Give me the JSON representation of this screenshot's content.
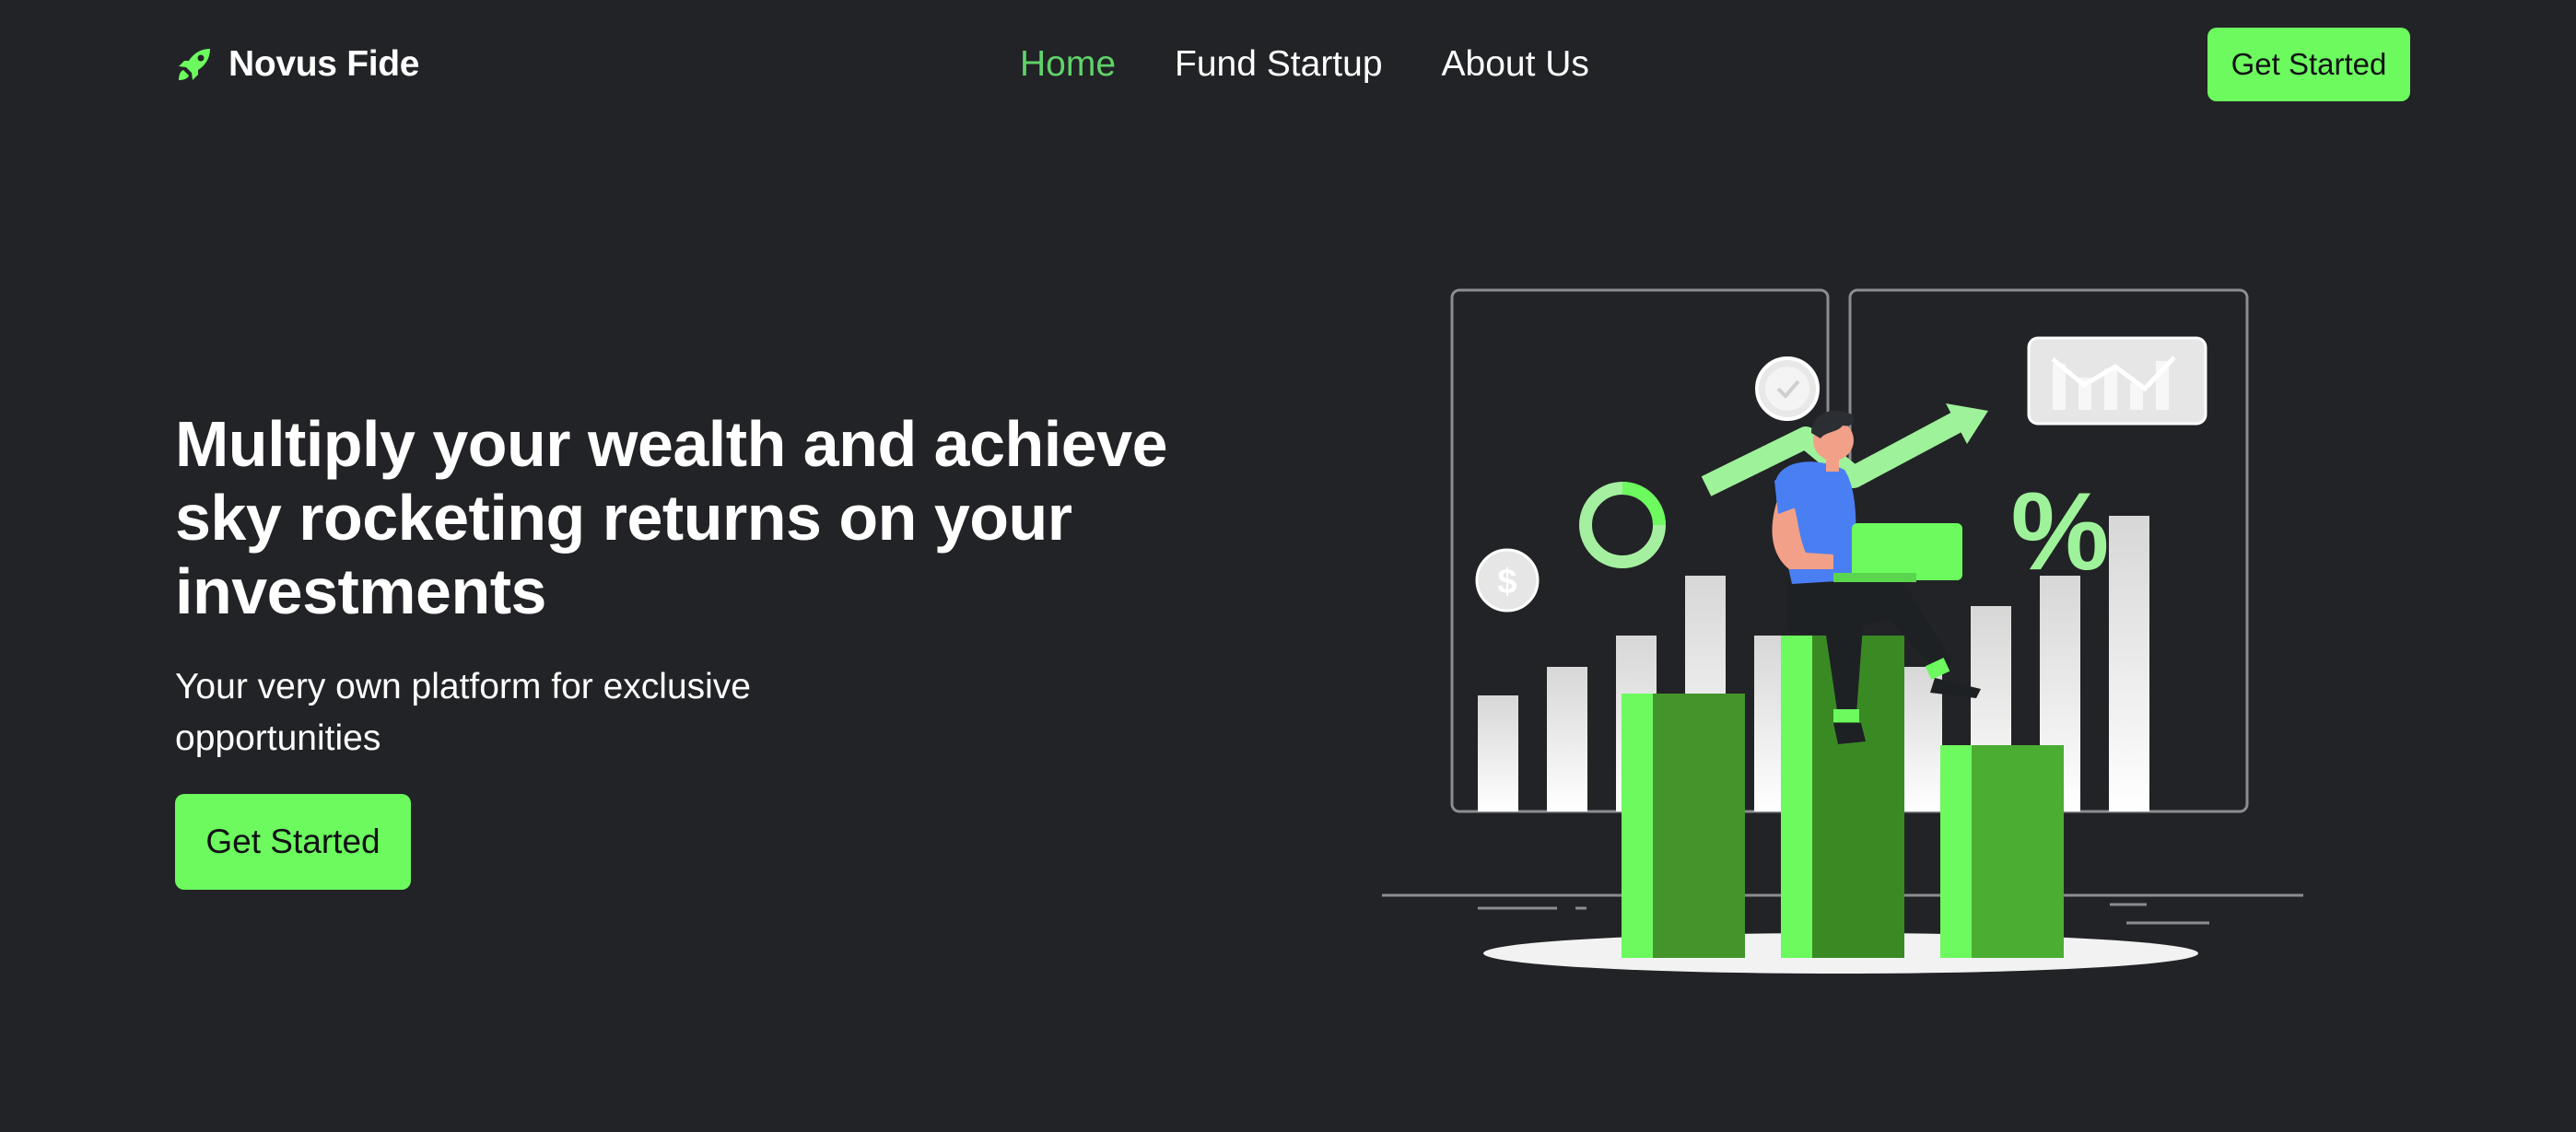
{
  "brand": {
    "name": "Novus Fide",
    "icon": "rocket-icon",
    "accent_color": "#6cfa5f"
  },
  "nav": {
    "links": [
      {
        "label": "Home",
        "active": true
      },
      {
        "label": "Fund Startup",
        "active": false
      },
      {
        "label": "About Us",
        "active": false
      }
    ],
    "cta_label": "Get Started"
  },
  "hero": {
    "title": "Multiply your wealth and achieve sky rocketing returns on your investments",
    "subtitle": "Your very own platform for exclusive opportunities",
    "cta_label": "Get Started"
  },
  "illustration": {
    "percent_symbol": "%",
    "dollar_symbol": "$"
  },
  "colors": {
    "background": "#222326",
    "active_link": "#5fd36a",
    "button": "#6cfa5f",
    "button_text": "#111214"
  }
}
